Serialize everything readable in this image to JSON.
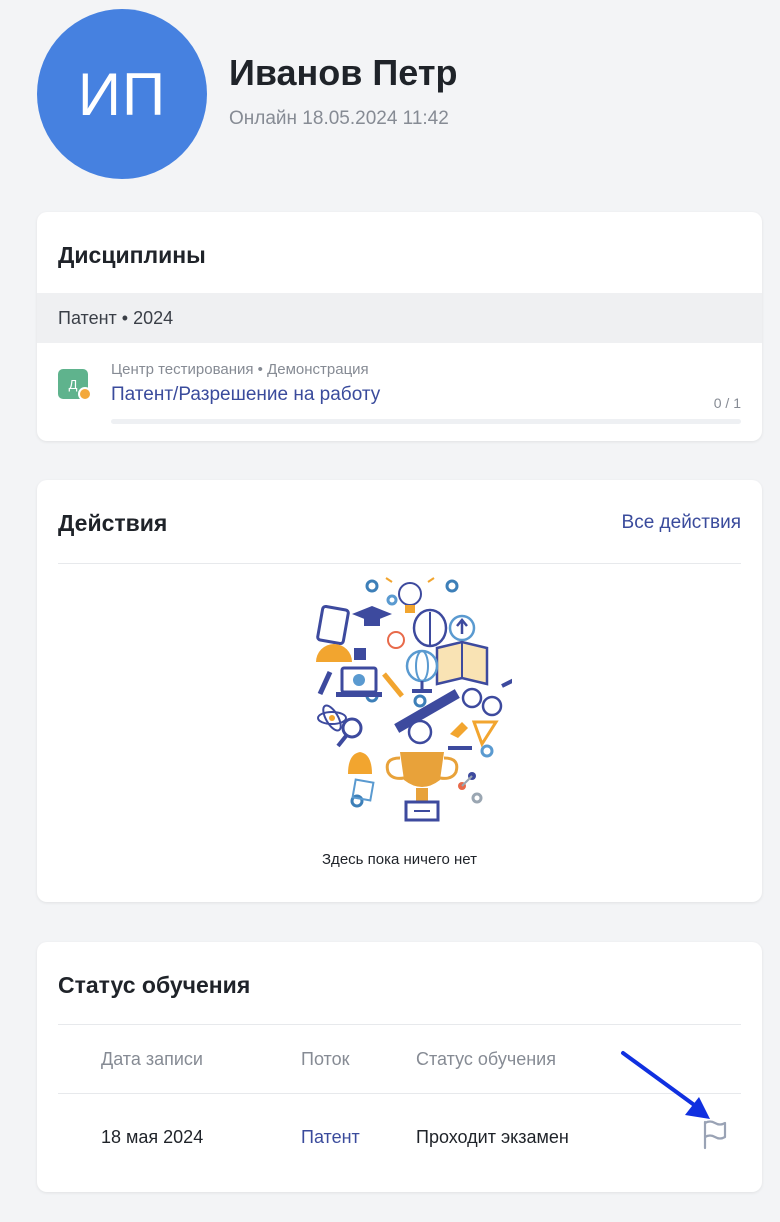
{
  "profile": {
    "initials": "ИП",
    "name": "Иванов Петр",
    "status": "Онлайн 18.05.2024 11:42",
    "avatar_color": "#4681e0"
  },
  "disciplines": {
    "title": "Дисциплины",
    "group": "Патент • 2024",
    "items": [
      {
        "icon_letter": "Д",
        "meta": "Центр тестирования • Демонстрация",
        "name": "Патент/Разрешение на работу",
        "progress_text": "0 / 1",
        "progress_fraction": 0
      }
    ]
  },
  "actions": {
    "title": "Действия",
    "all_link": "Все действия",
    "empty_text": "Здесь пока ничего нет"
  },
  "status": {
    "title": "Статус обучения",
    "columns": [
      "Дата записи",
      "Поток",
      "Статус обучения"
    ],
    "rows": [
      {
        "date": "18 мая 2024",
        "stream": "Патент",
        "status": "Проходит экзамен"
      }
    ]
  },
  "colors": {
    "accent": "#3a4b9c",
    "annotation_arrow": "#1030e0"
  }
}
